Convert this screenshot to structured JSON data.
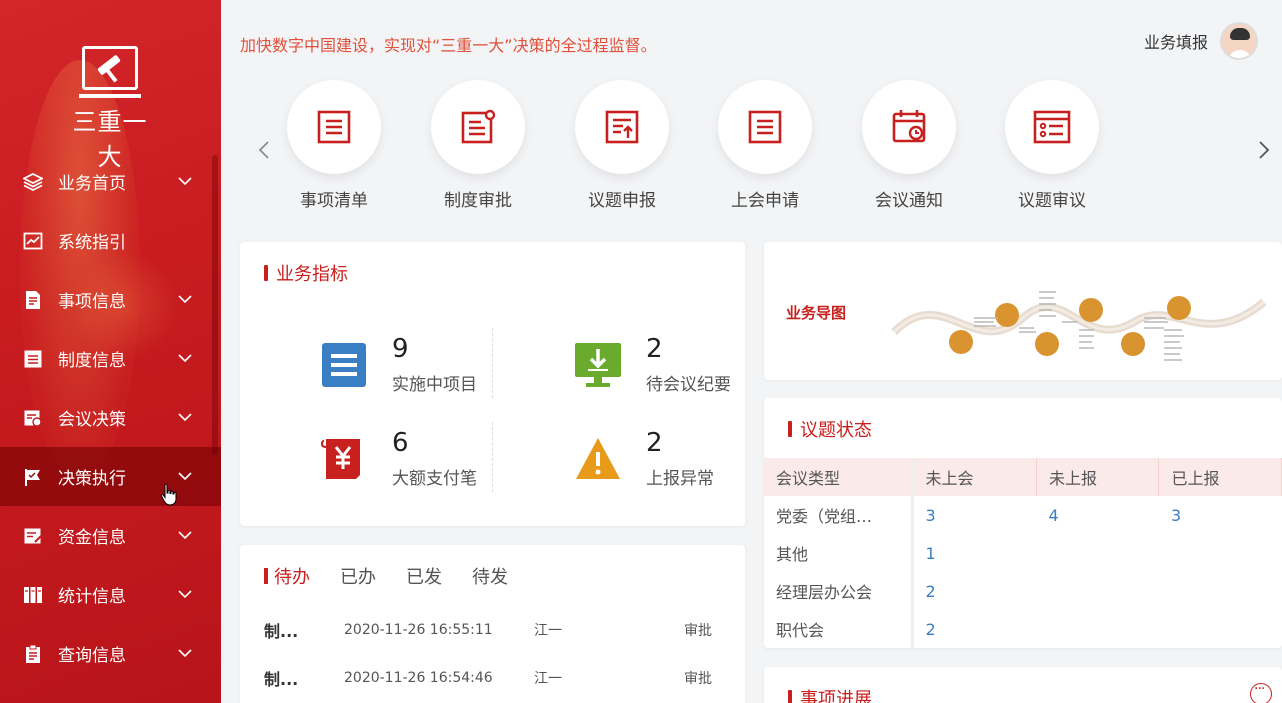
{
  "app": {
    "logo_text": "三重一大"
  },
  "sidebar": {
    "items": [
      {
        "label": "业务首页",
        "icon": "layers-icon",
        "chevron": true
      },
      {
        "label": "系统指引",
        "icon": "chart-line-icon",
        "chevron": false
      },
      {
        "label": "事项信息",
        "icon": "document-icon",
        "chevron": true
      },
      {
        "label": "制度信息",
        "icon": "list-icon",
        "chevron": true
      },
      {
        "label": "会议决策",
        "icon": "meeting-icon",
        "chevron": true
      },
      {
        "label": "决策执行",
        "icon": "flag-icon",
        "chevron": true,
        "active": true
      },
      {
        "label": "资金信息",
        "icon": "edit-icon",
        "chevron": true
      },
      {
        "label": "统计信息",
        "icon": "books-icon",
        "chevron": true
      },
      {
        "label": "查询信息",
        "icon": "clipboard-icon",
        "chevron": true
      }
    ]
  },
  "header": {
    "slogan": "加快数字中国建设，实现对“三重一大”决策的全过程监督。",
    "user_name": "业务填报"
  },
  "quick_nav": [
    {
      "label": "事项清单",
      "icon": "list-icon"
    },
    {
      "label": "制度审批",
      "icon": "doc-badge-icon"
    },
    {
      "label": "议题申报",
      "icon": "upload-doc-icon"
    },
    {
      "label": "上会申请",
      "icon": "list-icon"
    },
    {
      "label": "会议通知",
      "icon": "calendar-clock-icon"
    },
    {
      "label": "议题审议",
      "icon": "checklist-icon"
    }
  ],
  "metrics": {
    "title": "业务指标",
    "items": [
      {
        "value": "9",
        "label": "实施中项目",
        "color": "#3a7fc3"
      },
      {
        "value": "2",
        "label": "待会议纪要",
        "color": "#6aab2e"
      },
      {
        "value": "6",
        "label": "大额支付笔",
        "color": "#c8201e"
      },
      {
        "value": "2",
        "label": "上报异常",
        "color": "#e89a1a"
      }
    ]
  },
  "todo": {
    "tabs": [
      "待办",
      "已办",
      "已发",
      "待发"
    ],
    "rows": [
      {
        "title": "制...",
        "time": "2020-11-26 16:55:11",
        "user": "江一",
        "action": "审批"
      },
      {
        "title": "制...",
        "time": "2020-11-26 16:54:46",
        "user": "江一",
        "action": "审批"
      }
    ]
  },
  "map": {
    "title": "业务导图"
  },
  "topic_status": {
    "title": "议题状态",
    "headers": [
      "会议类型",
      "未上会",
      "未上报",
      "已上报"
    ],
    "rows": [
      [
        "党委（党组…",
        "3",
        "4",
        "3"
      ],
      [
        "其他",
        "1",
        "",
        ""
      ],
      [
        "经理层办公会",
        "2",
        "",
        ""
      ],
      [
        "职代会",
        "2",
        "",
        ""
      ]
    ]
  },
  "progress": {
    "title": "事项进展"
  }
}
